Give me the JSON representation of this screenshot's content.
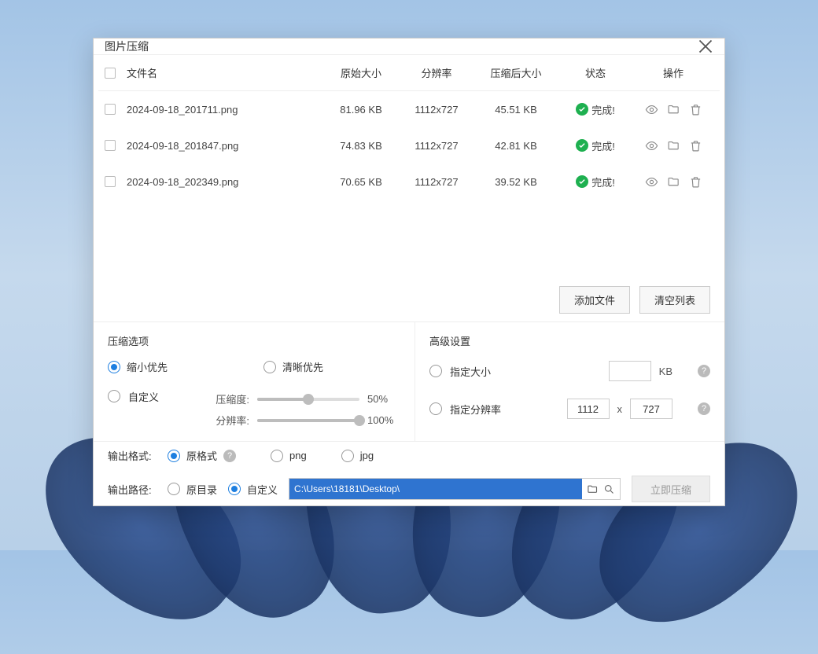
{
  "window": {
    "title": "图片压缩"
  },
  "table": {
    "headers": {
      "filename": "文件名",
      "original_size": "原始大小",
      "resolution": "分辨率",
      "compressed_size": "压缩后大小",
      "status": "状态",
      "actions": "操作"
    },
    "rows": [
      {
        "name": "2024-09-18_201711.png",
        "osize": "81.96 KB",
        "res": "1112x727",
        "csize": "45.51 KB",
        "status": "完成!"
      },
      {
        "name": "2024-09-18_201847.png",
        "osize": "74.83 KB",
        "res": "1112x727",
        "csize": "42.81 KB",
        "status": "完成!"
      },
      {
        "name": "2024-09-18_202349.png",
        "osize": "70.65 KB",
        "res": "1112x727",
        "csize": "39.52 KB",
        "status": "完成!"
      }
    ]
  },
  "buttons": {
    "add_file": "添加文件",
    "clear_list": "清空列表",
    "compress_now": "立即压缩"
  },
  "compress_opts": {
    "title": "压缩选项",
    "shrink_first": "缩小优先",
    "clarity_first": "清晰优先",
    "custom": "自定义",
    "ratio_label": "压缩度:",
    "ratio_value": "50%",
    "res_label": "分辨率:",
    "res_value": "100%"
  },
  "advanced": {
    "title": "高级设置",
    "size_label": "指定大小",
    "size_unit": "KB",
    "res_label": "指定分辨率",
    "res_w": "1112",
    "res_h": "727",
    "x": "x"
  },
  "format": {
    "label": "输出格式:",
    "original": "原格式",
    "png": "png",
    "jpg": "jpg"
  },
  "path": {
    "label": "输出路径:",
    "original_dir": "原目录",
    "custom": "自定义",
    "value": "C:\\Users\\18181\\Desktop\\"
  }
}
